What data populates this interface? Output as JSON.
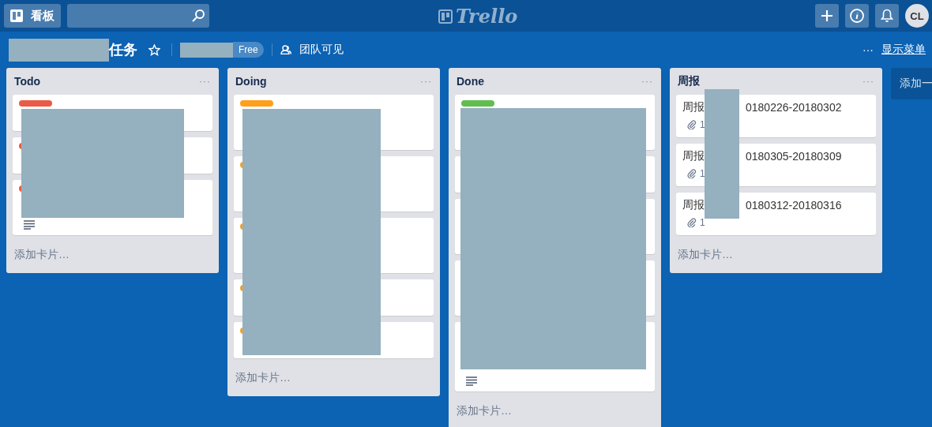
{
  "top_bar": {
    "boards_button": "看板",
    "logo": "Trello",
    "avatar": "CL"
  },
  "board": {
    "title": "任务",
    "plan_badge": "Free",
    "visibility": "团队可见",
    "menu_dots": "···",
    "menu_link": "显示菜单"
  },
  "lists": [
    {
      "title": "Todo",
      "menu": "···",
      "add_card": "添加卡片…",
      "cards": [
        {
          "color": "#eb5a46"
        },
        {
          "color": "#eb5a46"
        },
        {
          "color": "#eb5a46",
          "description": true
        }
      ]
    },
    {
      "title": "Doing",
      "menu": "···",
      "add_card": "添加卡片…",
      "cards": [
        {
          "color": "#ff9f1a"
        },
        {
          "color": "#ff9f1a"
        },
        {
          "color": "#ff9f1a"
        },
        {
          "color": "#ff9f1a"
        },
        {
          "color": "#ff9f1a"
        }
      ]
    },
    {
      "title": "Done",
      "menu": "···",
      "add_card": "添加卡片…",
      "cards": [
        {
          "color": "#61bd4f"
        },
        {
          "description": false
        },
        {
          "description": false
        },
        {
          "description": false
        },
        {
          "description": true
        }
      ]
    },
    {
      "title": "周报",
      "menu": "···",
      "add_card": "添加卡片…",
      "cards": [
        {
          "title_start": "周报",
          "title_end": "0180226-20180302",
          "attachments": "1"
        },
        {
          "title_start": "周报",
          "title_end": "0180305-20180309",
          "attachments": "1"
        },
        {
          "title_start": "周报",
          "title_end": "0180312-20180316",
          "attachments": "1"
        }
      ]
    }
  ],
  "add_list": "添加一"
}
